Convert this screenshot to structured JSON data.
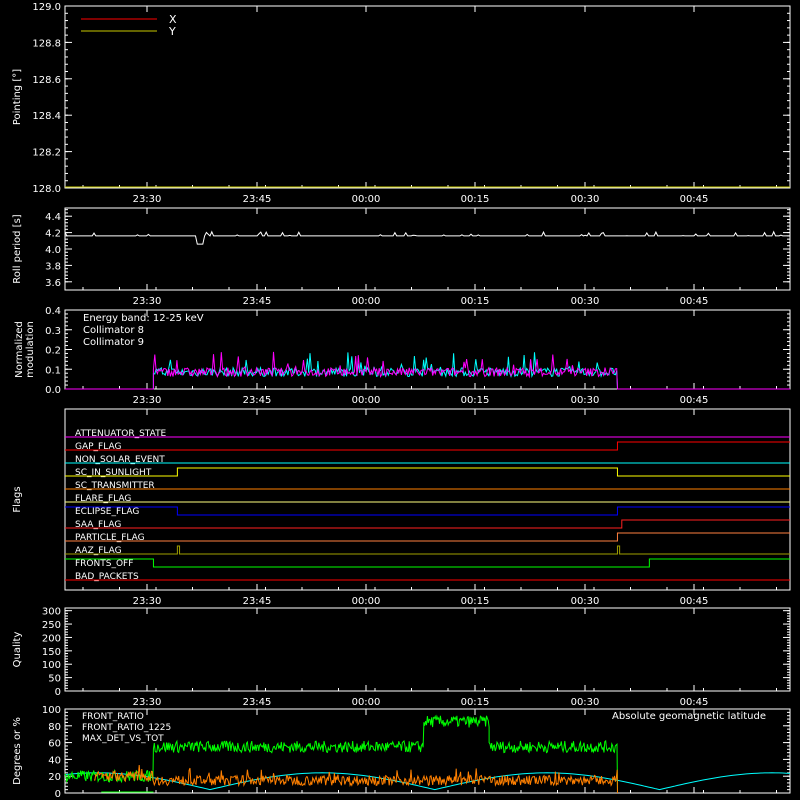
{
  "time_ticks": [
    "23:30",
    "23:45",
    "00:00",
    "00:15",
    "00:30",
    "00:45"
  ],
  "chart_data": [
    {
      "type": "line",
      "ylabel": "Pointing [°]",
      "ylim": [
        128.0,
        129.0
      ],
      "yticks": [
        "128.0",
        "128.2",
        "128.4",
        "128.6",
        "128.8",
        "129.0"
      ],
      "legend": [
        {
          "name": "X",
          "color": "#ff0000"
        },
        {
          "name": "Y",
          "color": "#c8c800"
        }
      ],
      "series": [
        {
          "name": "Y",
          "color": "#c8c800",
          "x": [
            0,
            100
          ],
          "y": [
            128.0,
            128.0
          ]
        }
      ]
    },
    {
      "type": "line",
      "ylabel": "Roll period [s]",
      "ylim": [
        3.5,
        4.5
      ],
      "yticks": [
        "3.6",
        "3.8",
        "4.0",
        "4.2",
        "4.4"
      ],
      "series": [
        {
          "name": "roll",
          "color": "#ffffff",
          "baseline": 4.16,
          "noise": 0.05,
          "dip_x": 18.6,
          "dip_y": 4.06
        }
      ]
    },
    {
      "type": "line",
      "ylabel": "Normalized modulation",
      "ylim": [
        0.0,
        0.4
      ],
      "yticks": [
        "0.0",
        "0.1",
        "0.2",
        "0.3",
        "0.4"
      ],
      "annotation": "Energy band: 12-25 keV",
      "legend": [
        {
          "name": "Collimator 8",
          "color": "#00ffff"
        },
        {
          "name": "Collimator 9",
          "color": "#ff00ff"
        }
      ],
      "active_range": [
        12.2,
        76.2
      ],
      "series": [
        {
          "name": "Collimator 8",
          "color": "#00ffff",
          "mean": 0.09
        },
        {
          "name": "Collimator 9",
          "color": "#ff00ff",
          "mean": 0.09
        }
      ]
    },
    {
      "type": "line",
      "ylabel": "Flags",
      "flags": [
        {
          "name": "ATTENUATOR_STATE",
          "color": "#ff00ff",
          "steps": [
            [
              0,
              0
            ]
          ]
        },
        {
          "name": "GAP_FLAG",
          "color": "#ff0000",
          "steps": [
            [
              0,
              0
            ],
            [
              76.2,
              1
            ]
          ]
        },
        {
          "name": "NON_SOLAR_EVENT",
          "color": "#00ffff",
          "steps": [
            [
              0,
              0
            ]
          ]
        },
        {
          "name": "SC_IN_SUNLIGHT",
          "color": "#ffff00",
          "steps": [
            [
              0,
              0
            ],
            [
              15.5,
              1
            ],
            [
              76.2,
              0
            ]
          ]
        },
        {
          "name": "SC_TRANSMITTER",
          "color": "#ff8000",
          "steps": [
            [
              0,
              0
            ]
          ]
        },
        {
          "name": "FLARE_FLAG",
          "color": "#ffff80",
          "steps": [
            [
              0,
              0
            ]
          ]
        },
        {
          "name": "ECLIPSE_FLAG",
          "color": "#0000ff",
          "steps": [
            [
              0,
              1
            ],
            [
              15.5,
              0
            ],
            [
              76.2,
              1
            ]
          ]
        },
        {
          "name": "SAA_FLAG",
          "color": "#ff2020",
          "steps": [
            [
              0,
              0
            ],
            [
              76.8,
              1
            ]
          ]
        },
        {
          "name": "PARTICLE_FLAG",
          "color": "#ff8040",
          "steps": [
            [
              0,
              0
            ],
            [
              76.2,
              1
            ]
          ]
        },
        {
          "name": "AAZ_FLAG",
          "color": "#a0a000",
          "steps": [
            [
              0,
              0
            ],
            [
              15.5,
              1
            ],
            [
              15.8,
              0
            ],
            [
              76.2,
              1
            ],
            [
              76.5,
              0
            ]
          ]
        },
        {
          "name": "FRONTS_OFF",
          "color": "#00ff00",
          "steps": [
            [
              0,
              1
            ],
            [
              12.2,
              0
            ],
            [
              80.6,
              1
            ]
          ]
        },
        {
          "name": "BAD_PACKETS",
          "color": "#ff0000",
          "steps": [
            [
              0,
              0
            ]
          ]
        }
      ]
    },
    {
      "type": "line",
      "ylabel": "Quality",
      "ylim": [
        0,
        310
      ],
      "yticks": [
        "0",
        "50",
        "100",
        "150",
        "200",
        "250",
        "300"
      ]
    },
    {
      "type": "line",
      "ylabel": "Degrees or %",
      "ylim": [
        0,
        100
      ],
      "yticks": [
        "0",
        "20",
        "40",
        "60",
        "80",
        "100"
      ],
      "legend": [
        {
          "name": "FRONT_RATIO",
          "color": "#ffff00"
        },
        {
          "name": "FRONT_RATIO_1225",
          "color": "#00ff00"
        },
        {
          "name": "MAX_DET_VS_TOT",
          "color": "#ff8000"
        }
      ],
      "annotation": "Absolute geomagnetic latitude",
      "annotation_color": "#00ffff",
      "series": [
        {
          "name": "FRONT_RATIO_1225",
          "color": "#00ff00",
          "segments": [
            [
              0,
              12.2,
              20
            ],
            [
              12.2,
              49.5,
              55
            ],
            [
              49.5,
              58.5,
              85
            ],
            [
              58.5,
              76.2,
              55
            ]
          ]
        },
        {
          "name": "MAX_DET_VS_TOT",
          "color": "#ff8000",
          "segments": [
            [
              4,
              12.2,
              20
            ],
            [
              12.2,
              76.2,
              15
            ]
          ]
        },
        {
          "name": "Absolute geomagnetic latitude",
          "color": "#00ffff"
        }
      ]
    }
  ]
}
